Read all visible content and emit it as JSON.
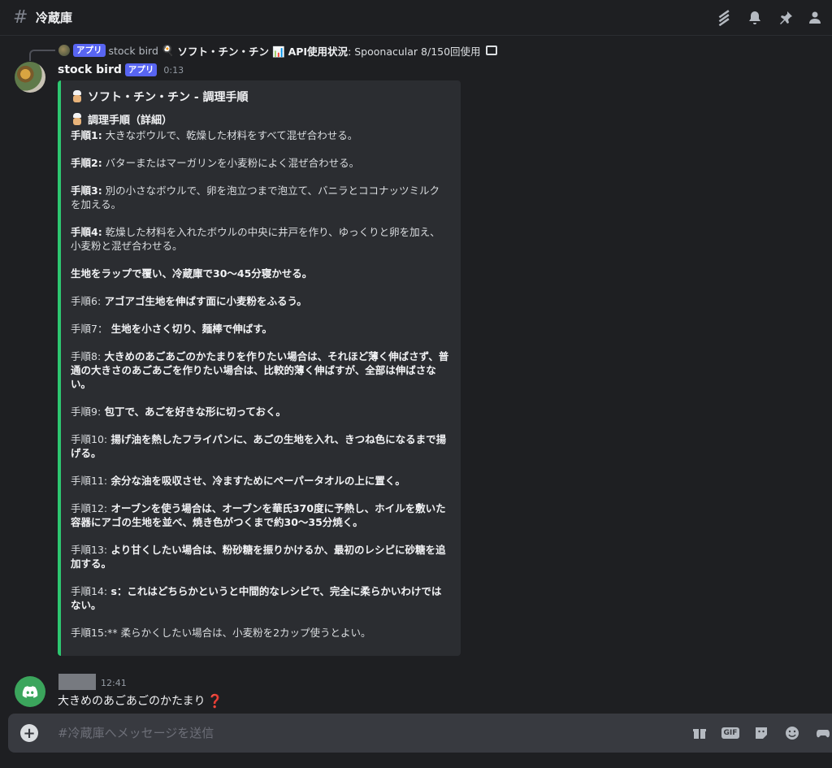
{
  "header": {
    "hash": "#",
    "channel": "冷蔵庫"
  },
  "reply": {
    "badge": "アプリ",
    "user": "stock bird",
    "title": "ソフト・チン・チン",
    "api_label": "API使用状況",
    "api_text": ": Spoonacular 8/150回使用"
  },
  "bot_message": {
    "username": "stock bird",
    "badge": "アプリ",
    "time": "0:13",
    "embed": {
      "title": "ソフト・チン・チン - 調理手順",
      "subtitle": "調理手順（詳細）",
      "steps": [
        {
          "label": "手順1:",
          "text": " 大きなボウルで、乾燥した材料をすべて混ぜ合わせる。",
          "label_bold": true,
          "text_bold": false
        },
        {
          "label": "手順2:",
          "text": " バターまたはマーガリンを小麦粉によく混ぜ合わせる。",
          "label_bold": true,
          "text_bold": false
        },
        {
          "label": "手順3:",
          "text": " 別の小さなボウルで、卵を泡立つまで泡立て、バニラとココナッツミルクを加える。",
          "label_bold": true,
          "text_bold": false
        },
        {
          "label": "手順4:",
          "text": " 乾燥した材料を入れたボウルの中央に井戸を作り、ゆっくりと卵を加え、小麦粉と混ぜ合わせる。",
          "label_bold": true,
          "text_bold": false
        },
        {
          "label": "",
          "text": "生地をラップで覆い、冷蔵庫で30〜45分寝かせる。",
          "label_bold": false,
          "text_bold": true
        },
        {
          "label": "手順6:",
          "text": " アゴアゴ生地を伸ばす面に小麦粉をふるう。",
          "label_bold": false,
          "text_bold": true
        },
        {
          "label": "手順7：",
          "text": " 生地を小さく切り、麺棒で伸ばす。",
          "label_bold": false,
          "text_bold": true
        },
        {
          "label": "手順8:",
          "text": " 大きめのあごあごのかたまりを作りたい場合は、それほど薄く伸ばさず、普通の大きさのあごあごを作りたい場合は、比較的薄く伸ばすが、全部は伸ばさない。",
          "label_bold": false,
          "text_bold": true
        },
        {
          "label": "手順9:",
          "text": " 包丁で、あごを好きな形に切っておく。",
          "label_bold": false,
          "text_bold": true
        },
        {
          "label": "手順10:",
          "text": " 揚げ油を熱したフライパンに、あごの生地を入れ、きつね色になるまで揚げる。",
          "label_bold": false,
          "text_bold": true
        },
        {
          "label": "手順11:",
          "text": " 余分な油を吸収させ、冷ますためにペーパータオルの上に置く。",
          "label_bold": false,
          "text_bold": true
        },
        {
          "label": "手順12:",
          "text": " オーブンを使う場合は、オーブンを華氏370度に予熱し、ホイルを敷いた容器にアゴの生地を並べ、焼き色がつくまで約30〜35分焼く。",
          "label_bold": false,
          "text_bold": true
        },
        {
          "label": "手順13:",
          "text": " より甘くしたい場合は、粉砂糖を振りかけるか、最初のレシピに砂糖を追加する。",
          "label_bold": false,
          "text_bold": true
        },
        {
          "label": "手順14:",
          "text": " s：これはどちらかというと中間的なレシピで、完全に柔らかいわけではない。",
          "label_bold": false,
          "text_bold": true
        },
        {
          "label": "手順15:**",
          "text": " 柔らかくしたい場合は、小麦粉を2カップ使うとよい。",
          "label_bold": false,
          "text_bold": false
        }
      ]
    }
  },
  "user_message": {
    "time": "12:41",
    "text": "大きめのあごあごのかたまり",
    "emoji": "❓"
  },
  "composer": {
    "placeholder": "#冷蔵庫へメッセージを送信",
    "gif_label": "GIF"
  },
  "colors": {
    "accent": "#5865f2",
    "embed_border": "#2dc770",
    "background": "#1e1f22"
  }
}
